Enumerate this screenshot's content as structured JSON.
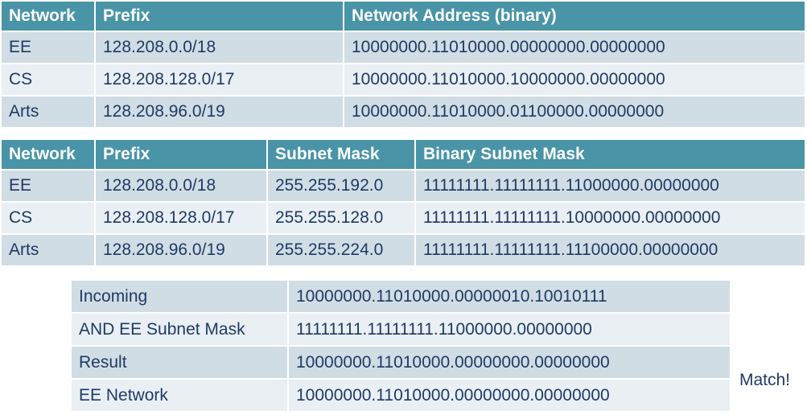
{
  "network_table": {
    "headers": [
      "Network",
      "Prefix",
      "Network Address (binary)"
    ],
    "rows": [
      [
        "EE",
        "128.208.0.0/18",
        "10000000.11010000.00000000.00000000"
      ],
      [
        "CS",
        "128.208.128.0/17",
        "10000000.11010000.10000000.00000000"
      ],
      [
        "Arts",
        "128.208.96.0/19",
        "10000000.11010000.01100000.00000000"
      ]
    ]
  },
  "mask_table": {
    "headers": [
      "Network",
      "Prefix",
      "Subnet Mask",
      "Binary Subnet Mask"
    ],
    "rows": [
      [
        "EE",
        "128.208.0.0/18",
        "255.255.192.0",
        "11111111.11111111.11000000.00000000"
      ],
      [
        "CS",
        "128.208.128.0/17",
        "255.255.128.0",
        "11111111.11111111.10000000.00000000"
      ],
      [
        "Arts",
        "128.208.96.0/19",
        "255.255.224.0",
        "11111111.11111111.11100000.00000000"
      ]
    ]
  },
  "and_table": {
    "rows": [
      [
        "Incoming",
        "10000000.11010000.00000010.10010111"
      ],
      [
        "AND EE Subnet Mask",
        "11111111.11111111.11000000.00000000"
      ],
      [
        "Result",
        "10000000.11010000.00000000.00000000"
      ],
      [
        "EE Network",
        "10000000.11010000.00000000.00000000"
      ]
    ]
  },
  "match_label": "Match!",
  "colors": {
    "header_bg": "#4994a6",
    "row_dark": "#d1dde4",
    "row_light": "#e9eff3",
    "text": "#1f3a66"
  }
}
